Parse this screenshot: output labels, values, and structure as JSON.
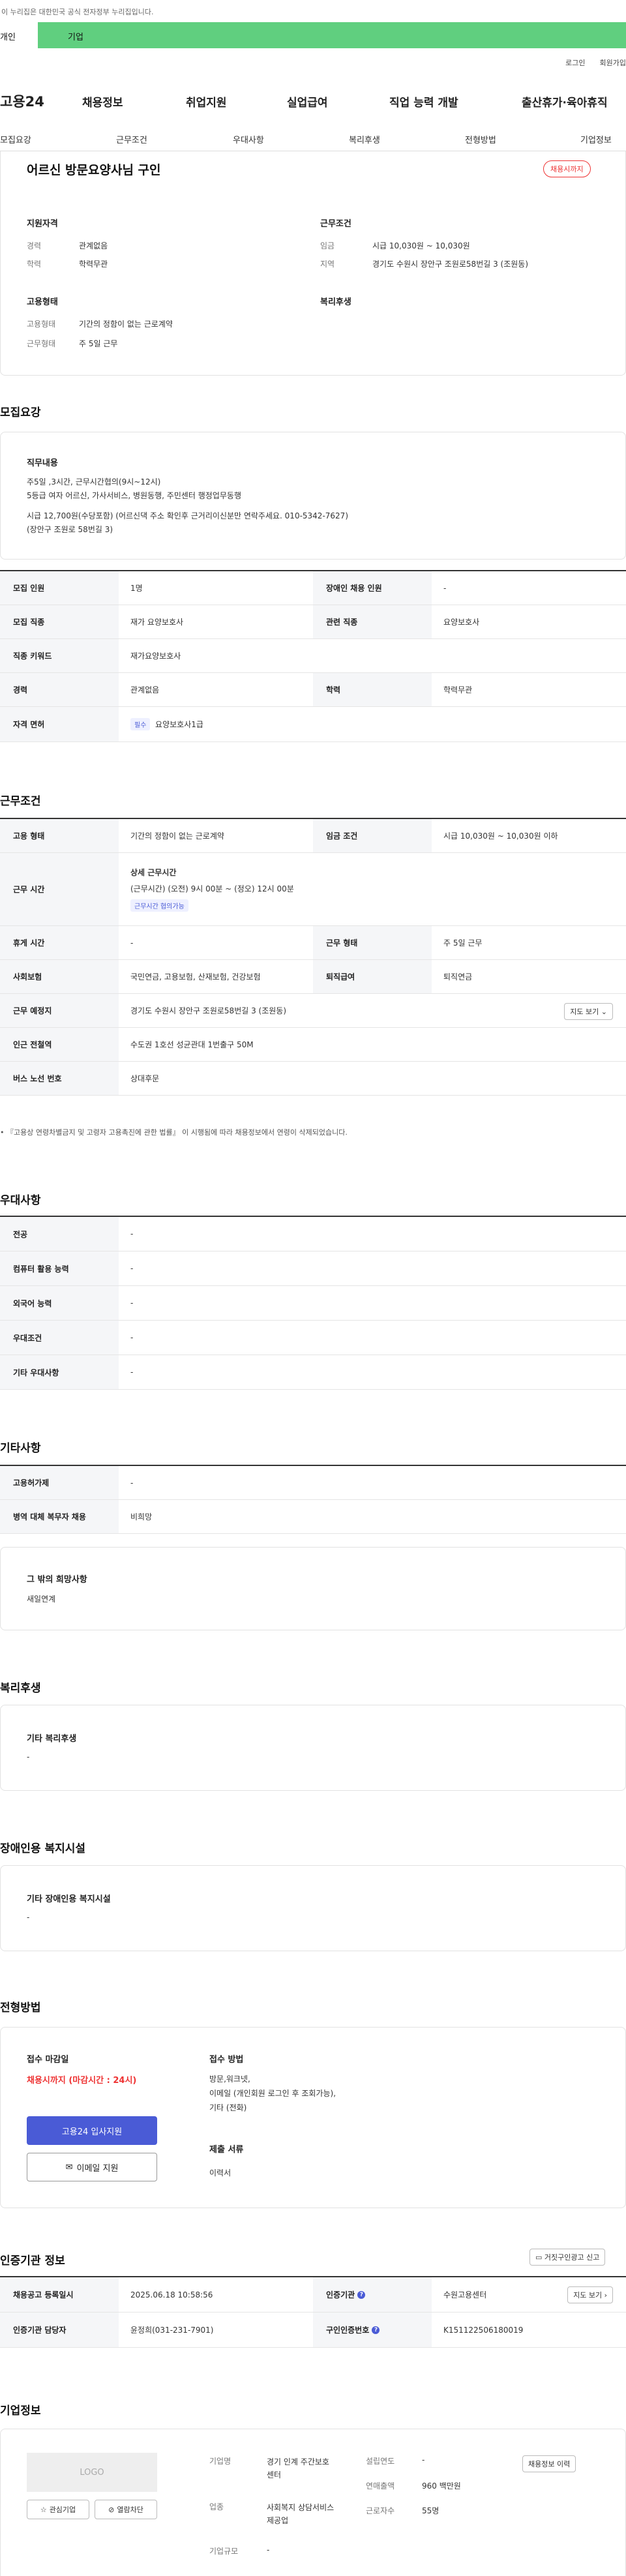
{
  "gov_banner": "이 누리집은 대한민국 공식 전자정부 누리집입니다.",
  "topbar": {
    "tab_person": "개인",
    "tab_company": "기업"
  },
  "util": {
    "login": "로그인",
    "signup": "회원가입"
  },
  "gnb": {
    "logo": "고용24",
    "items": [
      "채용정보",
      "취업지원",
      "실업급여",
      "직업 능력 개발",
      "출산휴가·육아휴직"
    ]
  },
  "tabs": [
    "모집요강",
    "근무조건",
    "우대사항",
    "복리후생",
    "전형방법",
    "기업정보"
  ],
  "summary": {
    "title": "어르신 방문요양사님 구인",
    "status": "채용시까지",
    "qual_title": "지원자격",
    "career_label": "경력",
    "career": "관계없음",
    "edu_label": "학력",
    "edu": "학력무관",
    "work_title": "근무조건",
    "wage_label": "임금",
    "wage": "시급 10,030원 ~ 10,030원",
    "region_label": "지역",
    "region": "경기도 수원시 장안구 조원로58번길 3 (조원동)",
    "emp_title": "고용형태",
    "emp_label": "고용형태",
    "emp": "기간의 정함이 없는 근로계약",
    "workday_label": "근무형태",
    "workday": "주 5일 근무",
    "welfare_title": "복리후생"
  },
  "recruit": {
    "section": "모집요강",
    "duty_title": "직무내용",
    "duty_lines": [
      "주5일 ,3시간, 근무시간협의(9시~12시)",
      "5등급   여자 어르신, 가사서비스, 병원동행, 주민센터 행정업무동행",
      "",
      "시급 12,700원(수당포함) (어르신댁 주소 확인후 근거리이신분만 연락주세요. 010-5342-7627)",
      "(장안구 조원로 58번길 3)"
    ],
    "rows": [
      [
        "모집 인원",
        "1명",
        "장애인 채용 인원",
        "-"
      ],
      [
        "모집 직종",
        "재가 요양보호사",
        "관련 직종",
        "요양보호사"
      ],
      [
        "직종 키워드",
        "재가요양보호사",
        "",
        ""
      ],
      [
        "경력",
        "관계없음",
        "학력",
        "학력무관"
      ],
      [
        "자격 면허",
        "요양보호사1급",
        "",
        ""
      ]
    ],
    "license_badge": "필수"
  },
  "work": {
    "section": "근무조건",
    "rows": [
      [
        "고용 형태",
        "기간의 정함이 없는 근로계약",
        "임금 조건",
        "시급 10,030원 ~ 10,030원 이하"
      ],
      [
        "휴게 시간",
        "-",
        "근무 형태",
        "주 5일 근무"
      ],
      [
        "사회보험",
        "국민연금, 고용보험, 산재보험, 건강보험",
        "퇴직급여",
        "퇴직연금"
      ],
      [
        "근무 예정지",
        "경기도 수원시 장안구 조원로58번길 3 (조원동)",
        "",
        ""
      ],
      [
        "인근 전철역",
        "수도권 1호선 성균관대 1번출구 50M",
        "",
        ""
      ],
      [
        "버스 노선 번호",
        "상대후문",
        "",
        ""
      ]
    ],
    "hours_label": "근무 시간",
    "hours_title": "상세 근무시간",
    "hours_detail": "(근무시간) (오전) 9시 00분 ~ (정오) 12시 00분",
    "hours_badge": "근무시간 협의가능",
    "map_btn": "지도 보기",
    "note": "『고용상 연령차별금지 및 고령자 고용촉진에 관한 법률』 이 시행됨에 따라 채용정보에서 연령이 삭제되었습니다."
  },
  "pref": {
    "section": "우대사항",
    "rows": [
      [
        "전공",
        "-"
      ],
      [
        "컴퓨터 활용 능력",
        "-"
      ],
      [
        "외국어 능력",
        "-"
      ],
      [
        "우대조건",
        "-"
      ],
      [
        "기타 우대사항",
        "-"
      ]
    ]
  },
  "etc": {
    "section": "기타사항",
    "rows": [
      [
        "고용허가제",
        "-"
      ],
      [
        "병역 대체 복무자 채용",
        "비희망"
      ]
    ],
    "other_title": "그 밖의 희망사항",
    "other_value": "새일연계"
  },
  "welfare": {
    "section": "복리후생",
    "title": "기타 복리후생",
    "value": "-"
  },
  "disabled": {
    "section": "장애인용 복지시설",
    "title": "기타 장애인용 복지시설",
    "value": "-"
  },
  "process": {
    "section": "전형방법",
    "deadline_title": "접수 마감일",
    "deadline": "채용시까지 (마감시간 : 24시)",
    "apply_btn": "고용24 입사지원",
    "email_btn": "이메일 지원",
    "method_title": "접수 방법",
    "method_lines": [
      "방문,워크넷,",
      "이메일 (개인회원 로그인 후 조회가능),",
      "기타 (전화)"
    ],
    "docs_title": "제출 서류",
    "docs": "이력서"
  },
  "cert": {
    "section": "인증기관 정보",
    "report_btn": "거짓구인광고 신고",
    "rows": [
      [
        "채용공고 등록일시",
        "2025.06.18 10:58:56",
        "인증기관",
        "수원고용센터"
      ],
      [
        "인증기관 담당자",
        "윤정희(031-231-7901)",
        "구인인증번호",
        "K151122506180019"
      ]
    ],
    "map_btn": "지도 보기"
  },
  "company": {
    "section": "기업정보",
    "logo": "LOGO",
    "fav_btn": "관심기업",
    "block_btn": "열람차단",
    "name_label": "기업명",
    "name": "경기 인계 주간보호센터",
    "est_label": "설립연도",
    "est": "-",
    "industry_label": "업종",
    "industry": "사회복지 상담서비스 제공업",
    "sales_label": "연매출액",
    "sales": "960 백만원",
    "emp_label": "근로자수",
    "emp": "55명",
    "scale_label": "기업규모",
    "scale": "-",
    "history_btn": "채용정보 이력"
  },
  "colors": {
    "green": "#60cf7f",
    "primary": "#4a5bd6",
    "red": "#e33333"
  }
}
